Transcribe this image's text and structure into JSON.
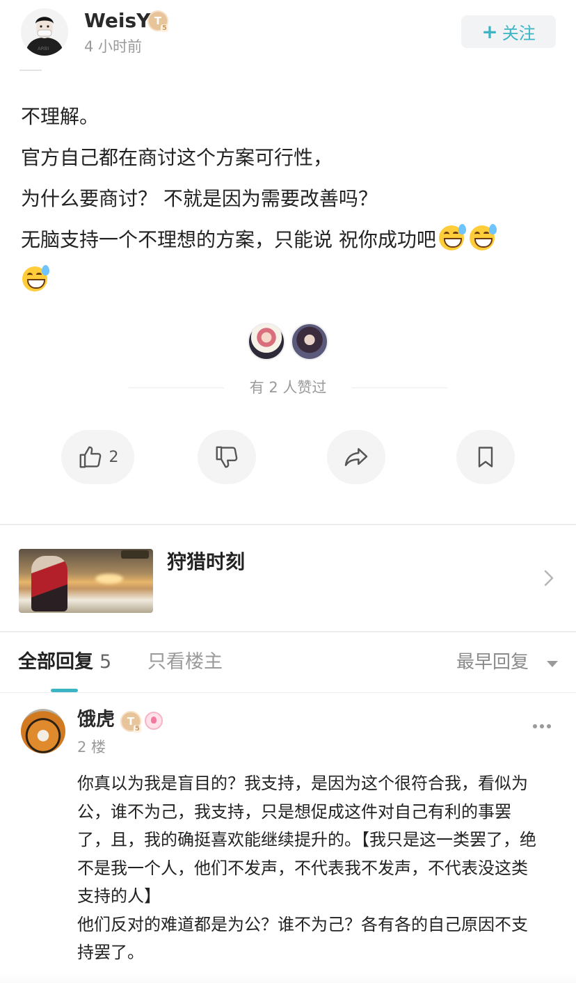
{
  "post": {
    "author": {
      "name": "WeisY",
      "level_badge": "T",
      "level_sub": "5",
      "time": "4 小时前",
      "avatar_icon": "masked-person-avatar"
    },
    "follow_label": "关注",
    "lines": [
      "不理解。",
      "官方自己都在商讨这个方案可行性，",
      "为什么要商讨？ 不就是因为需要改善吗？",
      "无脑支持一个不理想的方案，只能说 祝你成功吧"
    ],
    "emoji_count": 3,
    "emoji_icon": "grinning-sweat-emoji"
  },
  "likes": {
    "text": "有 2 人赞过",
    "liker_icons": [
      "anime-girl-avatar",
      "dark-hair-girl-avatar"
    ]
  },
  "actions": {
    "like_count": "2",
    "icons": [
      "thumbs-up-icon",
      "thumbs-down-icon",
      "share-icon",
      "bookmark-icon"
    ]
  },
  "topic": {
    "title": "狩猎时刻",
    "image_icon": "game-art-thumbnail"
  },
  "tabs": {
    "all_label": "全部回复",
    "all_count": "5",
    "op_label": "只看楼主",
    "sort_label": "最早回复"
  },
  "reply": {
    "name": "饿虎",
    "level_badge": "T",
    "level_sub": "5",
    "floor": "2 楼",
    "avatar_icon": "tiger-avatar",
    "paragraphs": [
      "你真以为我是盲目的？我支持，是因为这个很符合我，看似为公，谁不为己，我支持，只是想促成这件对自己有利的事罢了，且，我的确挺喜欢能继续提升的。【我只是这一类罢了，绝不是我一个人，他们不发声，不代表我不发声，不代表没这类支持的人】",
      "他们反对的难道都是为公？谁不为己？各有各的自己原因不支持罢了。"
    ]
  },
  "colors": {
    "accent": "#3bb4c4",
    "text": "#222222",
    "muted": "#9a9a9a",
    "button_bg": "#f4f4f4"
  }
}
